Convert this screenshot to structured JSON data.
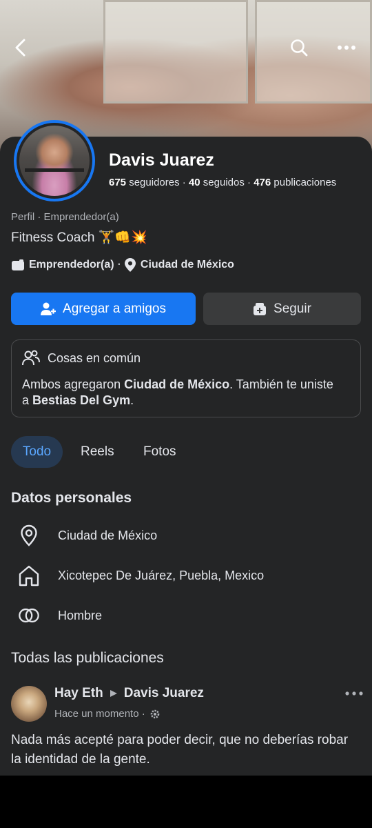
{
  "profile": {
    "name": "Davis Juarez",
    "followers_count": "675",
    "followers_label": "seguidores",
    "following_count": "40",
    "following_label": "seguidos",
    "posts_count": "476",
    "posts_label": "publicaciones",
    "category_line": "Perfil · Emprendedor(a)",
    "bio": "Fitness Coach 🏋️👊💥",
    "occupation": "Emprendedor(a)",
    "location": "Ciudad de México"
  },
  "actions": {
    "add_friend_label": "Agregar a amigos",
    "follow_label": "Seguir"
  },
  "common": {
    "title": "Cosas en común",
    "text_1": "Ambos agregaron ",
    "bold_1": "Ciudad de México",
    "text_2": ". También te uniste",
    "text_3": "a ",
    "bold_2": "Bestias Del Gym",
    "text_4": "."
  },
  "tabs": [
    {
      "label": "Todo",
      "active": true
    },
    {
      "label": "Reels",
      "active": false
    },
    {
      "label": "Fotos",
      "active": false
    }
  ],
  "personal": {
    "title": "Datos personales",
    "items": [
      {
        "icon": "location-pin-icon",
        "label": "Ciudad de México"
      },
      {
        "icon": "home-icon",
        "label": "Xicotepec De Juárez, Puebla, Mexico"
      },
      {
        "icon": "gender-rings-icon",
        "label": "Hombre"
      }
    ]
  },
  "posts": {
    "title": "Todas las publicaciones",
    "first": {
      "author": "Hay Eth",
      "target": "Davis Juarez",
      "time": "Hace un momento ·",
      "text": "Nada más acepté para poder decir, que no deberías robar la identidad de la gente."
    }
  },
  "colors": {
    "accent": "#1877f2",
    "panel": "#242526",
    "secondary_button": "#3a3b3c",
    "active_tab_bg": "#263951",
    "active_tab_text": "#5aa7ff"
  }
}
